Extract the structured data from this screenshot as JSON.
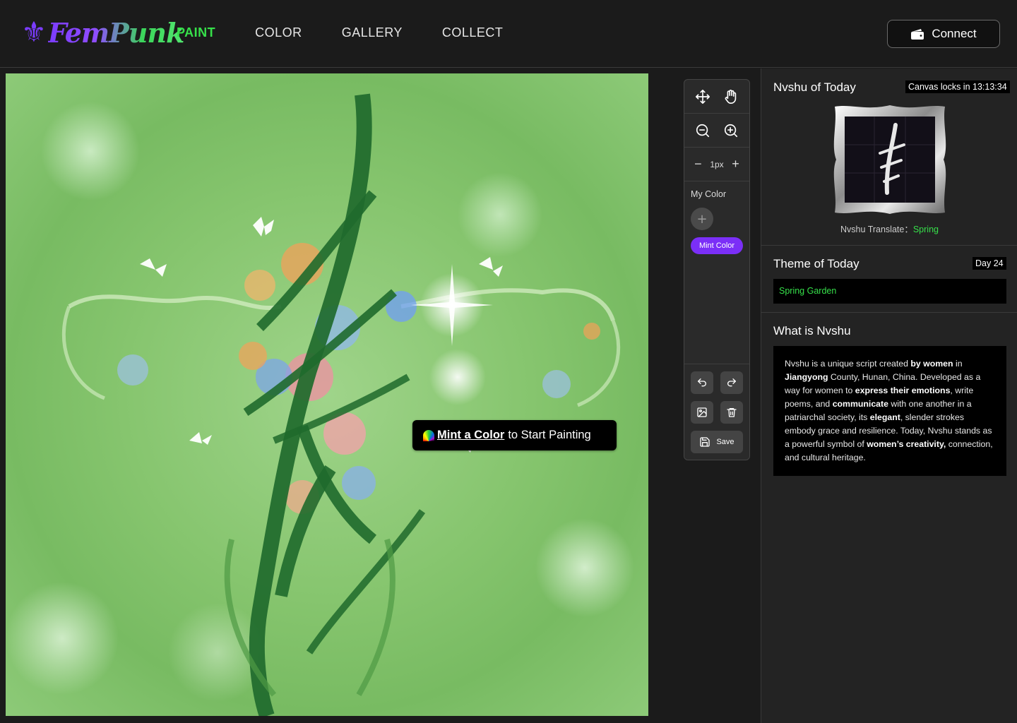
{
  "brand": {
    "name": "FemPunk"
  },
  "nav": [
    {
      "label": "PAINT",
      "active": true
    },
    {
      "label": "COLOR",
      "active": false
    },
    {
      "label": "GALLERY",
      "active": false
    },
    {
      "label": "COLLECT",
      "active": false
    }
  ],
  "header": {
    "connect_label": "Connect"
  },
  "canvas": {
    "hint_link": "Mint a Color",
    "hint_rest": "to Start Painting"
  },
  "toolbar": {
    "brush_size": "1px",
    "my_color_label": "My Color",
    "add_color": "+",
    "mint_color_label": "Mint Color",
    "save_label": "Save"
  },
  "panel": {
    "nvshu_title": "Nvshu of Today",
    "lock_timer": "Canvas locks in 13:13:34",
    "translate_label": "Nvshu Translate：",
    "translate_value": "Spring",
    "theme_title": "Theme of Today",
    "day_badge": "Day 24",
    "theme_value": "Spring Garden",
    "about_title": "What is Nvshu",
    "about": {
      "p1": "Nvshu is a unique script created ",
      "b1": "by women",
      "p2": " in ",
      "b2": "Jiangyong",
      "p3": " County, Hunan, China. Developed as a way for women to ",
      "b3": "express their emotions",
      "p4": ", write poems, and ",
      "b4": "communicate",
      "p5": " with one another in a patriarchal society, its ",
      "b5": "elegant",
      "p6": ", slender strokes embody grace and resilience. Today, Nvshu stands as a powerful symbol of ",
      "b6": "women’s creativity,",
      "p7": " connection, and cultural heritage."
    }
  },
  "colors": {
    "accent_green": "#36e04a",
    "accent_purple": "#7b2ff7",
    "background": "#1b1b1b"
  }
}
